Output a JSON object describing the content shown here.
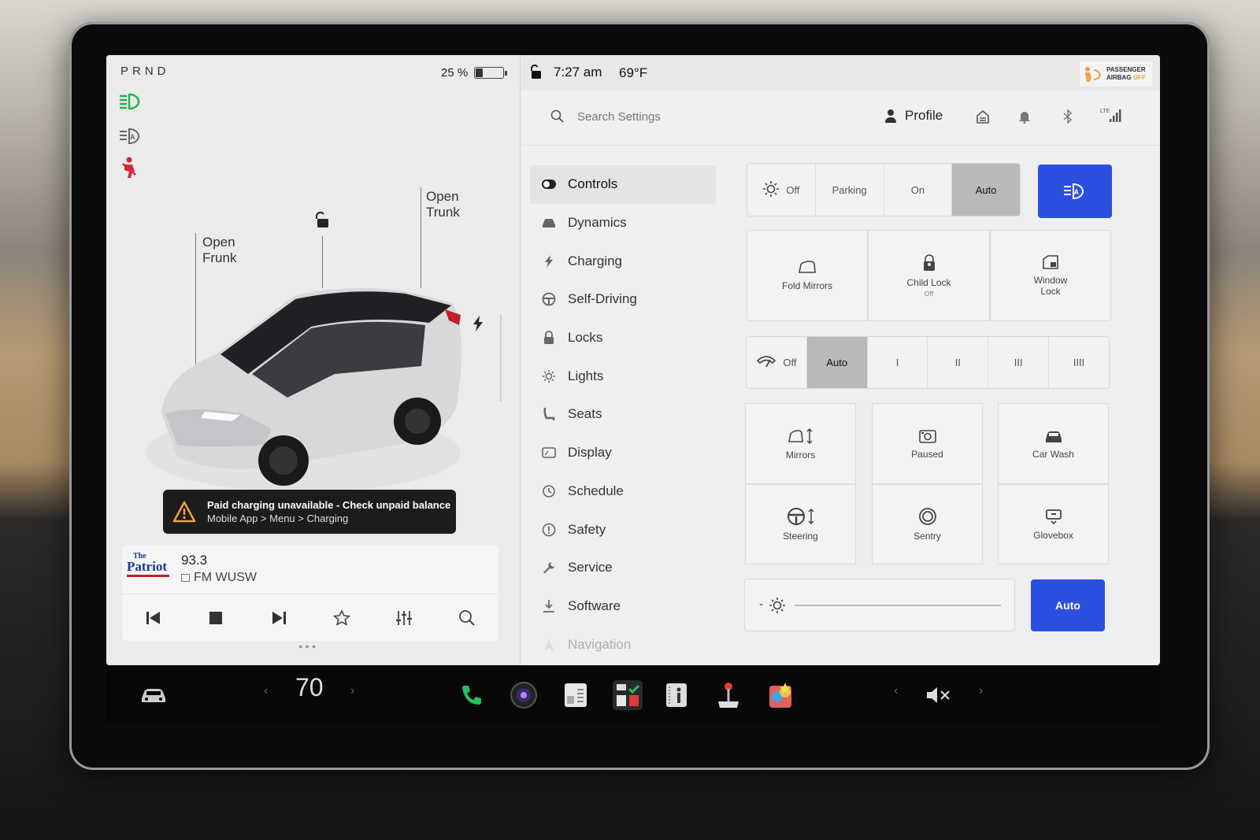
{
  "status": {
    "gear": "PRND",
    "battery_percent_label": "25 %",
    "battery_level": 0.25,
    "time": "7:27 am",
    "temperature": "69°F",
    "airbag_line1": "PASSENGER",
    "airbag_line2": "AIRBAG",
    "airbag_state": "OFF"
  },
  "car": {
    "frunk_line1": "Open",
    "frunk_line2": "Frunk",
    "trunk_line1": "Open",
    "trunk_line2": "Trunk"
  },
  "alert": {
    "title": "Paid charging unavailable - Check unpaid balance",
    "path": "Mobile App > Menu > Charging"
  },
  "media": {
    "logo_lines": [
      "The",
      "Patriot"
    ],
    "frequency": "93.3",
    "station": "FM WUSW"
  },
  "search": {
    "placeholder": "Search Settings"
  },
  "profile": {
    "label": "Profile"
  },
  "nav": {
    "items": [
      {
        "label": "Controls",
        "icon": "toggle-icon"
      },
      {
        "label": "Dynamics",
        "icon": "car-icon"
      },
      {
        "label": "Charging",
        "icon": "bolt-icon"
      },
      {
        "label": "Self-Driving",
        "icon": "steering-wheel-icon"
      },
      {
        "label": "Locks",
        "icon": "lock-icon"
      },
      {
        "label": "Lights",
        "icon": "sun-icon"
      },
      {
        "label": "Seats",
        "icon": "seat-icon"
      },
      {
        "label": "Display",
        "icon": "display-icon"
      },
      {
        "label": "Schedule",
        "icon": "clock-icon"
      },
      {
        "label": "Safety",
        "icon": "alert-circle-icon"
      },
      {
        "label": "Service",
        "icon": "wrench-icon"
      },
      {
        "label": "Software",
        "icon": "download-icon"
      },
      {
        "label": "Navigation",
        "icon": "navigation-icon"
      }
    ]
  },
  "lights": {
    "options": [
      "Off",
      "Parking",
      "On",
      "Auto"
    ],
    "selected": "Auto"
  },
  "tiles_row1": {
    "fold_mirrors": "Fold Mirrors",
    "child_lock": "Child Lock",
    "child_lock_state": "Off",
    "window_lock_line1": "Window",
    "window_lock_line2": "Lock"
  },
  "wipers": {
    "options": [
      "Off",
      "Auto",
      "I",
      "II",
      "III",
      "IIII"
    ],
    "selected": "Auto"
  },
  "tiles_grid": {
    "mirrors": "Mirrors",
    "paused": "Paused",
    "car_wash": "Car Wash",
    "steering": "Steering",
    "sentry": "Sentry",
    "glovebox": "Glovebox"
  },
  "brightness": {
    "minus": "-",
    "auto_label": "Auto"
  },
  "taskbar": {
    "cabin_temp": "70"
  },
  "colors": {
    "accent_blue": "#2d4fe0",
    "indicator_green": "#1fb84a",
    "seatbelt_red": "#d8263a",
    "airbag_off_orange": "#f0a050"
  }
}
